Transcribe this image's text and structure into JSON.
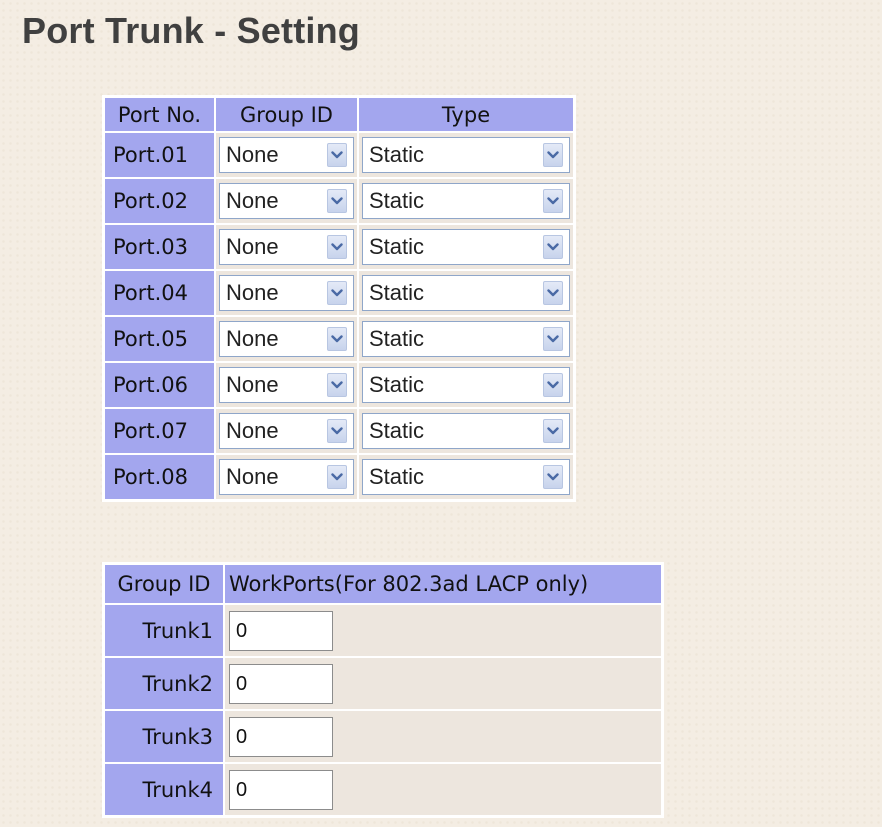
{
  "title": "Port Trunk - Setting",
  "port_table": {
    "headers": {
      "port_no": "Port No.",
      "group_id": "Group ID",
      "type": "Type"
    },
    "rows": [
      {
        "port": "Port.01",
        "group": "None",
        "type": "Static"
      },
      {
        "port": "Port.02",
        "group": "None",
        "type": "Static"
      },
      {
        "port": "Port.03",
        "group": "None",
        "type": "Static"
      },
      {
        "port": "Port.04",
        "group": "None",
        "type": "Static"
      },
      {
        "port": "Port.05",
        "group": "None",
        "type": "Static"
      },
      {
        "port": "Port.06",
        "group": "None",
        "type": "Static"
      },
      {
        "port": "Port.07",
        "group": "None",
        "type": "Static"
      },
      {
        "port": "Port.08",
        "group": "None",
        "type": "Static"
      }
    ]
  },
  "trunk_table": {
    "headers": {
      "group_id": "Group ID",
      "workports": "WorkPorts(For 802.3ad LACP only)"
    },
    "rows": [
      {
        "trunk": "Trunk1",
        "workports": "0"
      },
      {
        "trunk": "Trunk2",
        "workports": "0"
      },
      {
        "trunk": "Trunk3",
        "workports": "0"
      },
      {
        "trunk": "Trunk4",
        "workports": "0"
      }
    ]
  },
  "icons": {
    "dropdown": "chevron-down-icon"
  },
  "colors": {
    "header_bg": "#a3a6ee",
    "cell_bg": "#ede6de",
    "page_bg": "#f4ede3",
    "title_text": "#404040",
    "dropdown_arrow": "#4a6aa5"
  }
}
